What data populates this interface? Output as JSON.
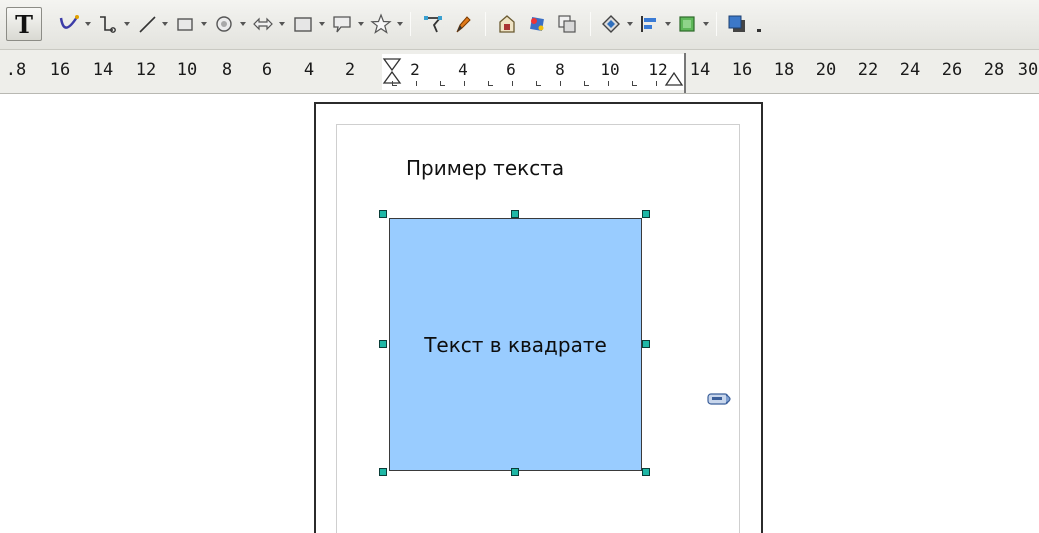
{
  "toolbar": {
    "text_tool_label": "T",
    "tools": [
      "text-tool-icon",
      "curve-icon",
      "connector-icon",
      "line-icon",
      "rectangle-icon",
      "ellipse-icon",
      "block-arrow-icon",
      "flowchart-icon",
      "callout-icon",
      "star-icon",
      "points-icon",
      "fontwork-icon",
      "from-file-icon",
      "extrusion-icon",
      "position-icon",
      "rotate-icon",
      "align-icon",
      "arrange-icon",
      "shadow-icon"
    ]
  },
  "ruler": {
    "left_numbers": [
      ".8",
      "16",
      "14",
      "12",
      "10",
      "8",
      "6",
      "4",
      "2"
    ],
    "inner_numbers": [
      "2",
      "4",
      "6",
      "8",
      "10",
      "12"
    ],
    "right_numbers": [
      "14",
      "16",
      "18",
      "20",
      "22",
      "24",
      "26",
      "28",
      "30"
    ]
  },
  "document": {
    "sample_text": "Пример текста",
    "shape_text": "Текст в квадрате",
    "shape_fill": "#99ccff",
    "handle_color": "#1fb8a6"
  }
}
